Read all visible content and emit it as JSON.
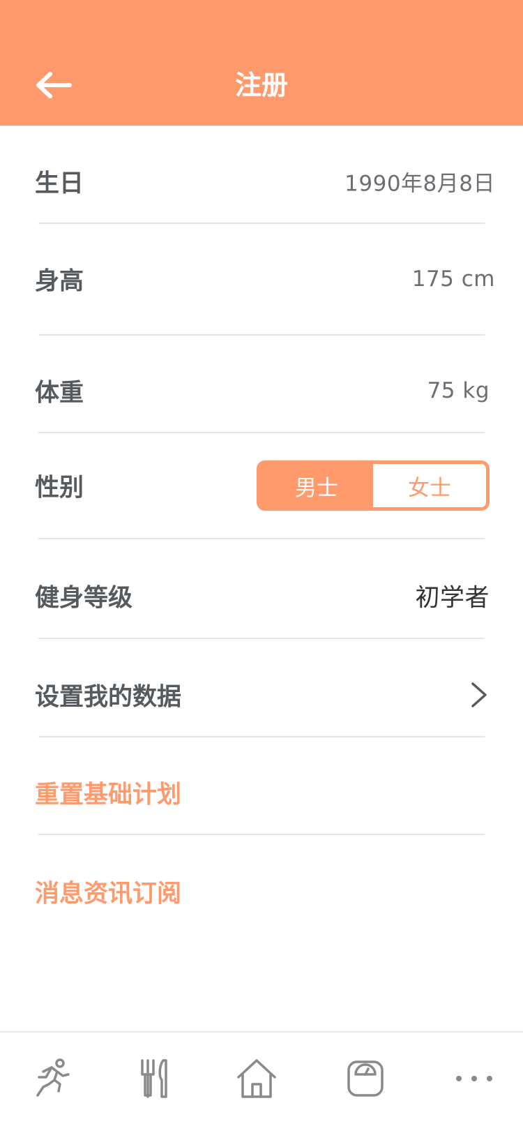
{
  "header": {
    "title": "注册"
  },
  "rows": {
    "birthday": {
      "label": "生日",
      "value": "1990年8月8日"
    },
    "height": {
      "label": "身高",
      "value": "175 cm"
    },
    "weight": {
      "label": "体重",
      "value": "75 kg"
    },
    "gender": {
      "label": "性别",
      "options": [
        "男士",
        "女士"
      ],
      "selected": "男士"
    },
    "fitness_level": {
      "label": "健身等级",
      "value": "初学者"
    },
    "my_data": {
      "label": "设置我的数据"
    },
    "reset_plan": {
      "label": "重置基础计划"
    },
    "news_subscription": {
      "label": "消息资讯订阅"
    }
  },
  "tabbar": {
    "items": [
      {
        "icon": "running-icon"
      },
      {
        "icon": "fork-knife-icon"
      },
      {
        "icon": "home-icon"
      },
      {
        "icon": "scale-icon"
      },
      {
        "icon": "more-icon"
      }
    ]
  },
  "colors": {
    "accent": "#FF9A6D",
    "label": "#555a5f",
    "value": "#6b6f73",
    "divider": "#e6e6e6",
    "icon": "#8a8a8a"
  }
}
